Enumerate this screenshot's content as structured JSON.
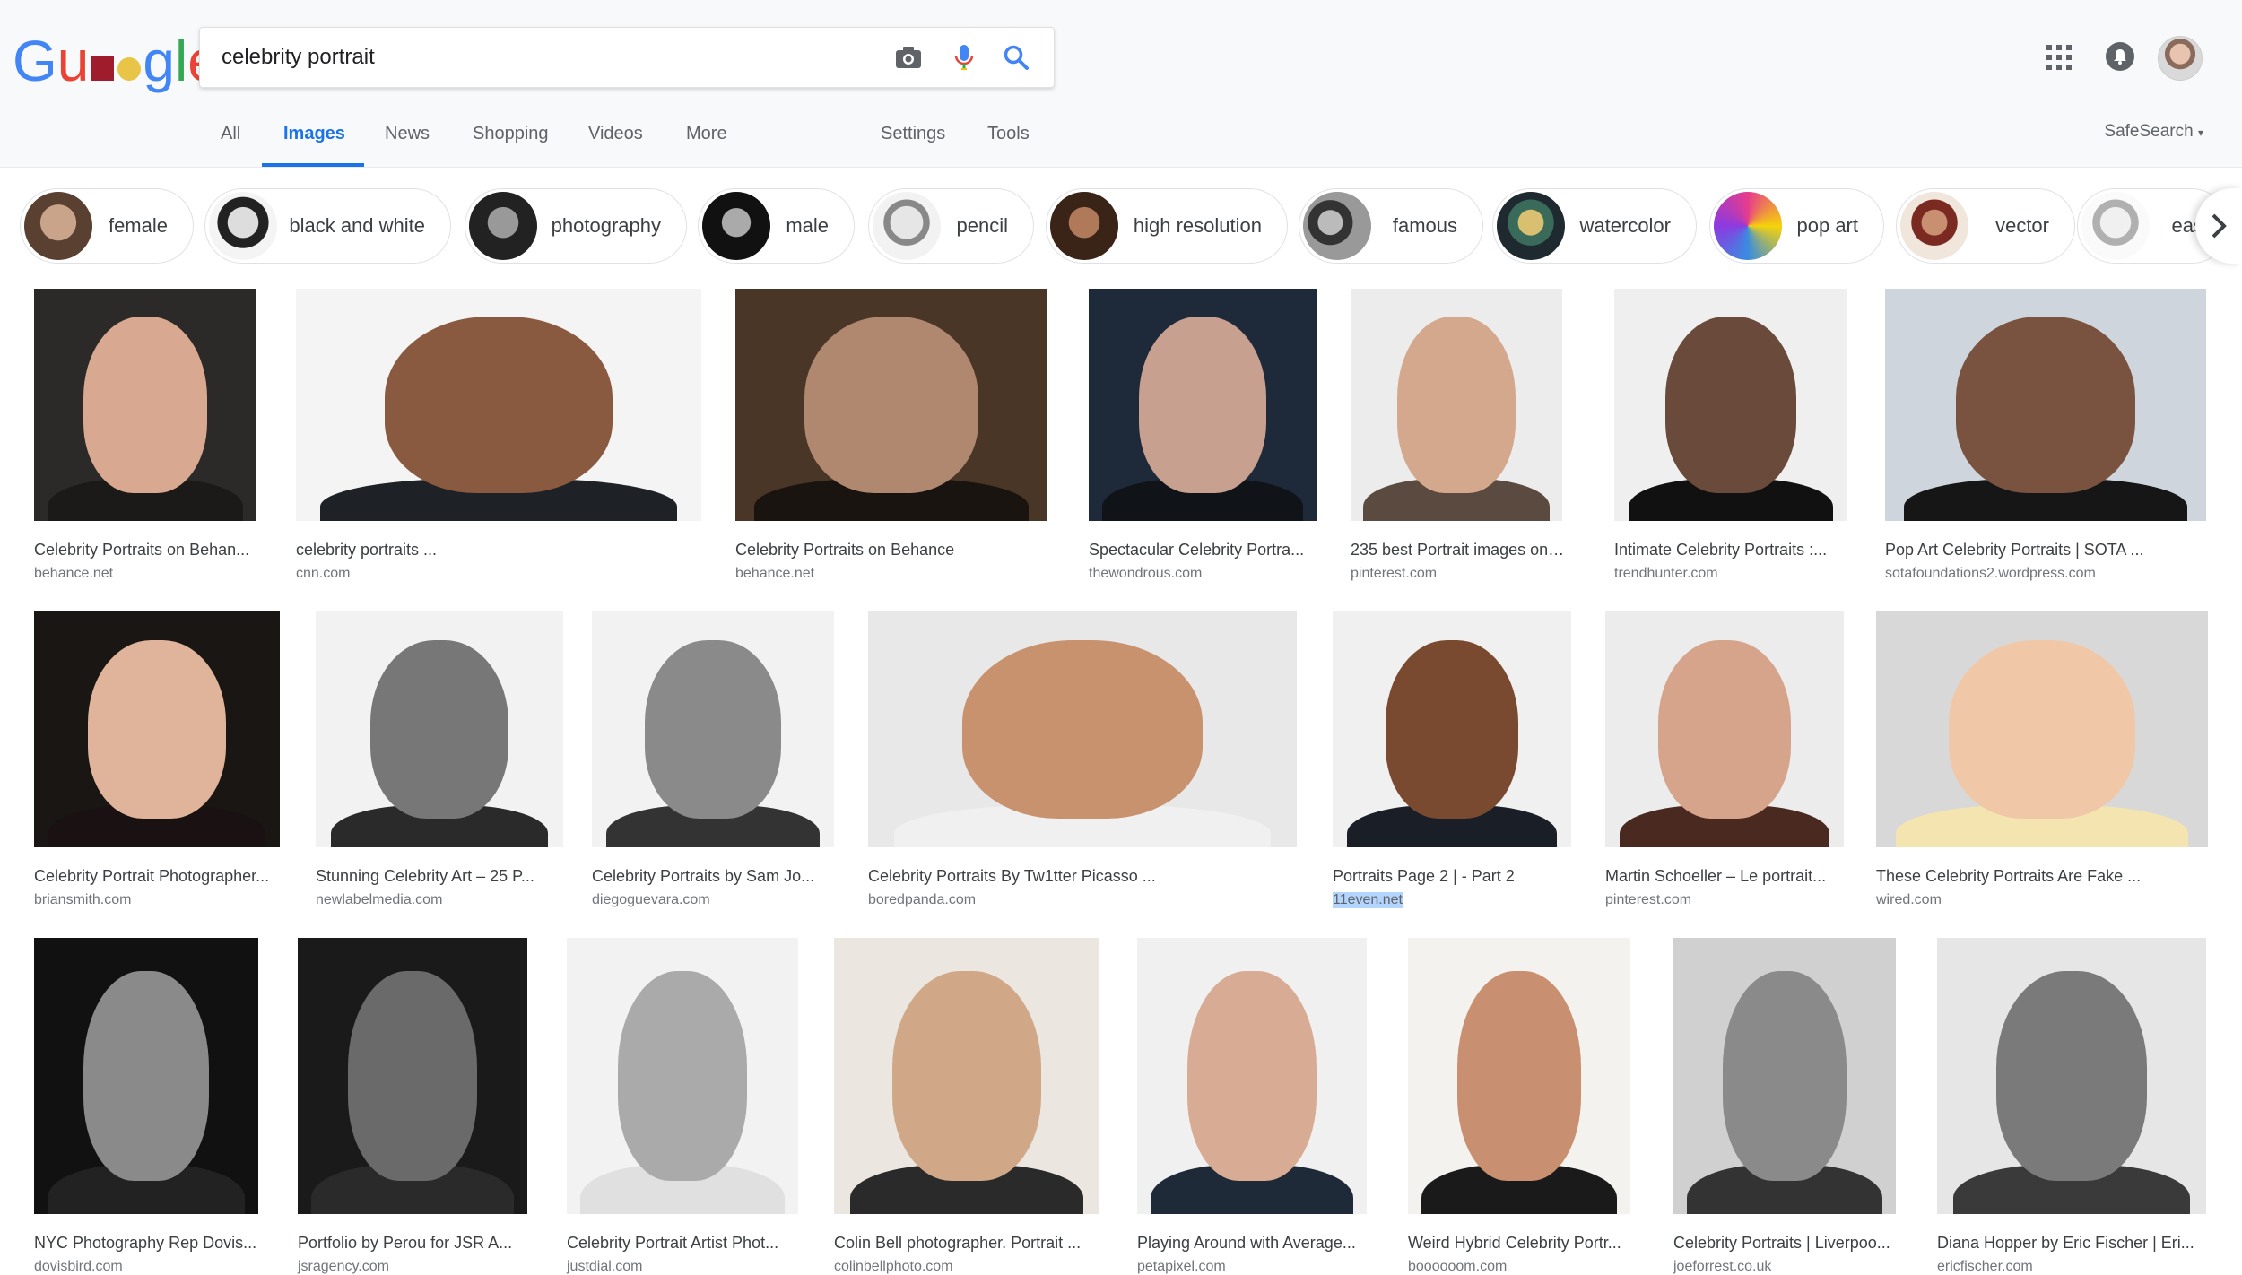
{
  "logo": {
    "letters": [
      "G",
      "u",
      "",
      "",
      "g",
      "l",
      "e"
    ]
  },
  "search": {
    "query": "celebrity portrait",
    "icons": [
      "camera-icon",
      "microphone-icon",
      "search-icon"
    ]
  },
  "tabs": [
    {
      "label": "All"
    },
    {
      "label": "Images"
    },
    {
      "label": "News"
    },
    {
      "label": "Shopping"
    },
    {
      "label": "Videos"
    },
    {
      "label": "More"
    },
    {
      "label": "Settings"
    },
    {
      "label": "Tools"
    }
  ],
  "safesearch": "SafeSearch",
  "chips": [
    {
      "label": "female"
    },
    {
      "label": "black and white"
    },
    {
      "label": "photography"
    },
    {
      "label": "male"
    },
    {
      "label": "pencil"
    },
    {
      "label": "high resolution"
    },
    {
      "label": "famous"
    },
    {
      "label": "watercolor"
    },
    {
      "label": "pop art"
    },
    {
      "label": "vector"
    },
    {
      "label": "eas"
    }
  ],
  "results": [
    {
      "title": "Celebrity Portraits on Behan...",
      "site": "behance.net"
    },
    {
      "title": "celebrity portraits ...",
      "site": "cnn.com"
    },
    {
      "title": "Celebrity Portraits on Behance",
      "site": "behance.net"
    },
    {
      "title": "Spectacular Celebrity Portra...",
      "site": "thewondrous.com"
    },
    {
      "title": "235 best Portrait images on ...",
      "site": "pinterest.com"
    },
    {
      "title": "Intimate Celebrity Portraits :...",
      "site": "trendhunter.com"
    },
    {
      "title": "Pop Art Celebrity Portraits | SOTA ...",
      "site": "sotafoundations2.wordpress.com"
    },
    {
      "title": "Celebrity Portrait Photographer...",
      "site": "briansmith.com"
    },
    {
      "title": "Stunning Celebrity Art – 25 P...",
      "site": "newlabelmedia.com"
    },
    {
      "title": "Celebrity Portraits by Sam Jo...",
      "site": "diegoguevara.com"
    },
    {
      "title": "Celebrity Portraits By Tw1tter Picasso ...",
      "site": "boredpanda.com"
    },
    {
      "title": "Portraits Page 2 | - Part 2",
      "site": "11even.net"
    },
    {
      "title": "Martin Schoeller – Le portrait...",
      "site": "pinterest.com"
    },
    {
      "title": "These Celebrity Portraits Are Fake ...",
      "site": "wired.com"
    },
    {
      "title": "NYC Photography Rep Dovis...",
      "site": "dovisbird.com"
    },
    {
      "title": "Portfolio by Perou for JSR A...",
      "site": "jsragency.com"
    },
    {
      "title": "Celebrity Portrait Artist Phot...",
      "site": "justdial.com"
    },
    {
      "title": "Colin Bell photographer. Portrait ...",
      "site": "colinbellphoto.com"
    },
    {
      "title": "Playing Around with Average...",
      "site": "petapixel.com"
    },
    {
      "title": "Weird Hybrid Celebrity Portr...",
      "site": "boooooom.com"
    },
    {
      "title": "Celebrity Portraits | Liverpoo...",
      "site": "joeforrest.co.uk"
    },
    {
      "title": "Diana Hopper by Eric Fischer | Eri...",
      "site": "ericfischer.com"
    }
  ],
  "colors": {
    "accent": "#1a73e8",
    "site_text": "#70757a",
    "title_text": "#3c4043"
  }
}
